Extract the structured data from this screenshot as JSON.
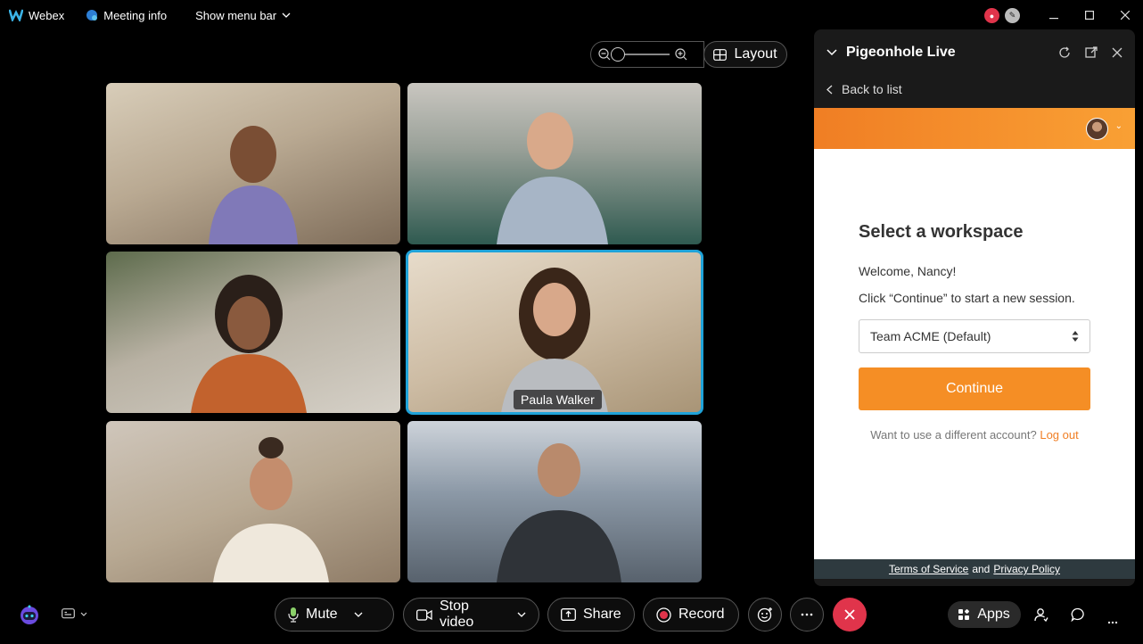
{
  "titlebar": {
    "app_name": "Webex",
    "meeting_info": "Meeting info",
    "show_menu_bar": "Show menu bar"
  },
  "view": {
    "layout_label": "Layout"
  },
  "participants": [
    {
      "name": "",
      "bg": "#b9a992"
    },
    {
      "name": "",
      "bg": "#7a8378"
    },
    {
      "name": "",
      "bg": "#8a7a64"
    },
    {
      "name": "Paula Walker",
      "bg": "#b6a58e"
    },
    {
      "name": "",
      "bg": "#a89680"
    },
    {
      "name": "",
      "bg": "#7d8b99"
    }
  ],
  "panel": {
    "title": "Pigeonhole Live",
    "back_label": "Back to list",
    "workspace_title": "Select a workspace",
    "welcome": "Welcome, Nancy!",
    "hint": "Click “Continue” to start a new session.",
    "selected_workspace": "Team ACME (Default)",
    "continue_label": "Continue",
    "alt_prompt": "Want to use a different account?",
    "logout_label": "Log out",
    "terms_label": "Terms of Service",
    "and_label": "and",
    "privacy_label": "Privacy Policy"
  },
  "toolbar": {
    "mute_label": "Mute",
    "stop_video_label": "Stop video",
    "share_label": "Share",
    "record_label": "Record",
    "apps_label": "Apps"
  },
  "colors": {
    "accent_orange": "#f58e25",
    "active_speaker": "#1fa3d9",
    "hangup_red": "#e0344b"
  }
}
